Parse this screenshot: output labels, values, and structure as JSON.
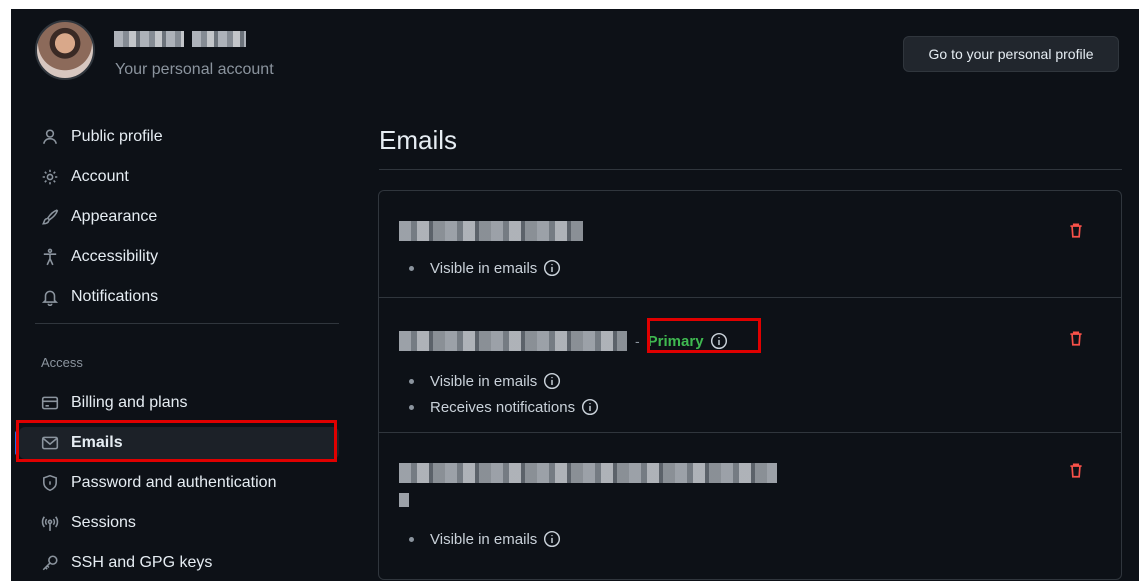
{
  "header": {
    "account_subtitle": "Your personal account",
    "profile_button": "Go to your personal profile"
  },
  "sidebar": {
    "items": [
      {
        "label": "Public profile",
        "icon": "person-icon"
      },
      {
        "label": "Account",
        "icon": "gear-icon"
      },
      {
        "label": "Appearance",
        "icon": "paintbrush-icon"
      },
      {
        "label": "Accessibility",
        "icon": "accessibility-icon"
      },
      {
        "label": "Notifications",
        "icon": "bell-icon"
      }
    ],
    "access_heading": "Access",
    "access_items": [
      {
        "label": "Billing and plans",
        "icon": "credit-card-icon"
      },
      {
        "label": "Emails",
        "icon": "mail-icon",
        "active": true
      },
      {
        "label": "Password and authentication",
        "icon": "shield-lock-icon"
      },
      {
        "label": "Sessions",
        "icon": "broadcast-icon"
      },
      {
        "label": "SSH and GPG keys",
        "icon": "key-icon"
      }
    ]
  },
  "main": {
    "title": "Emails",
    "emails": [
      {
        "bullets": [
          "Visible in emails"
        ]
      },
      {
        "badge": "Primary",
        "bullets": [
          "Visible in emails",
          "Receives notifications"
        ]
      },
      {
        "bullets": [
          "Visible in emails"
        ]
      }
    ]
  },
  "colors": {
    "background": "#0d1117",
    "border": "#30363d",
    "accent": "#1f6feb",
    "primary_badge": "#3fb950",
    "danger": "#f85149",
    "highlight_box": "#e00000"
  }
}
